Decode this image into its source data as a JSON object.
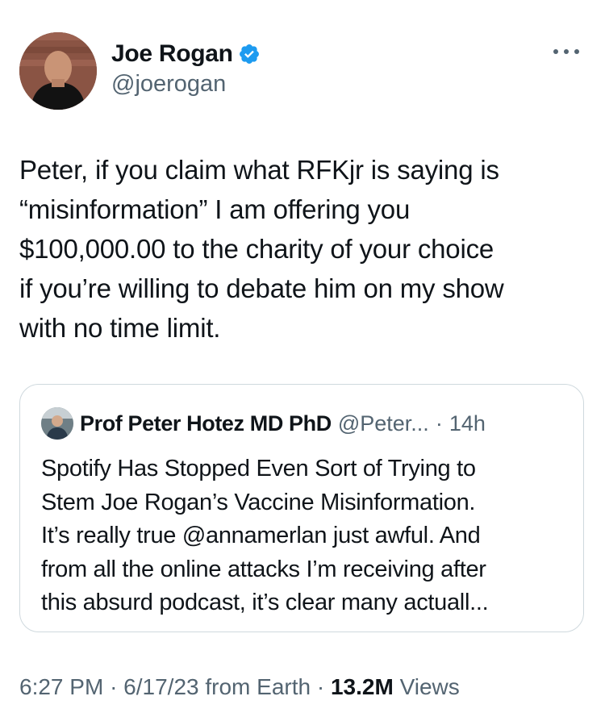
{
  "tweet": {
    "author": {
      "display_name": "Joe Rogan",
      "handle": "@joerogan",
      "verified": true
    },
    "text": "Peter, if you claim what RFKjr is saying is\n“misinformation” I am offering you\n$100,000.00 to the charity of your choice\nif you’re willing to debate him on my show\nwith no time limit.",
    "time": "6:27 PM",
    "date": "6/17/23",
    "source": "from Earth",
    "sep": "·",
    "views_count": "13.2M",
    "views_label": "Views"
  },
  "quote": {
    "author_name": "Prof Peter Hotez MD PhD",
    "handle": "@Peter...",
    "dot": "·",
    "time_ago": "14h",
    "text": "Spotify Has Stopped Even Sort of Trying to\nStem Joe Rogan’s Vaccine Misinformation.\nIt’s really true @annamerlan just awful. And\nfrom all the online attacks I’m receiving after\nthis absurd podcast, it’s clear many actuall..."
  },
  "colors": {
    "text": "#0f1419",
    "secondary": "#536471",
    "verified": "#1d9bf0",
    "border": "#cfd9de"
  },
  "icons": {
    "verified": "verified-badge-icon",
    "more": "more-horizontal-icon"
  }
}
